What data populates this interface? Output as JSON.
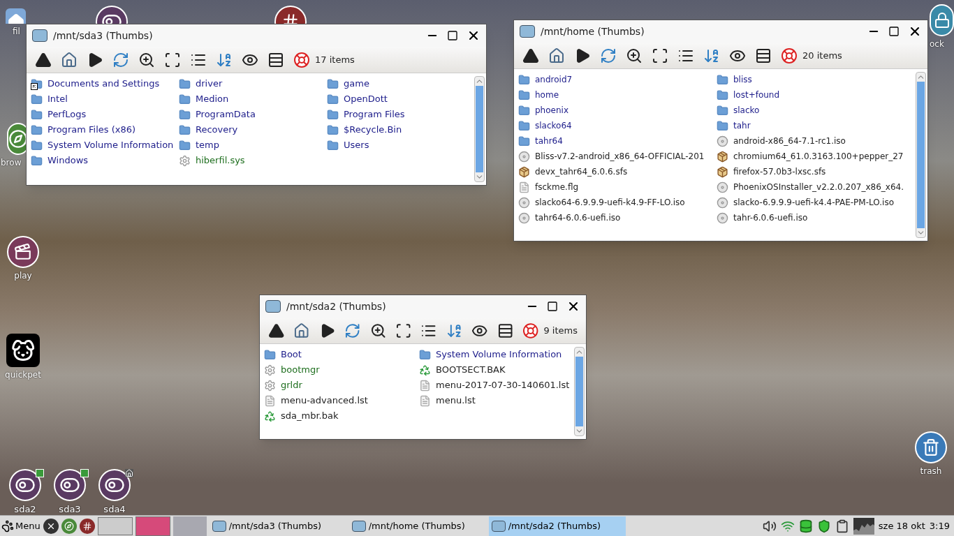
{
  "desktop_icons": [
    {
      "kind": "folder-home",
      "label": "fil"
    },
    {
      "kind": "toggle"
    },
    {
      "kind": "hash"
    },
    {
      "kind": "compass",
      "label": "brow"
    },
    {
      "kind": "clapper",
      "label": "play"
    },
    {
      "kind": "pet",
      "label": "quickpet"
    },
    {
      "kind": "lock",
      "label": "ock"
    },
    {
      "kind": "trash",
      "label": "trash"
    }
  ],
  "drives": [
    {
      "label": "sda2",
      "kind": "eject"
    },
    {
      "label": "sda3",
      "kind": "eject"
    },
    {
      "label": "sda4",
      "kind": "home"
    }
  ],
  "windows": [
    {
      "title": "/mnt/sda3 (Thumbs)",
      "item_count": "17 items",
      "columns": [
        [
          {
            "name": "Documents and Settings",
            "kind": "link-folder"
          },
          {
            "name": "Intel",
            "kind": "folder"
          },
          {
            "name": "PerfLogs",
            "kind": "folder"
          },
          {
            "name": "Program Files (x86)",
            "kind": "folder"
          },
          {
            "name": "System Volume Information",
            "kind": "folder"
          },
          {
            "name": "Windows",
            "kind": "folder"
          }
        ],
        [
          {
            "name": "driver",
            "kind": "folder"
          },
          {
            "name": "Medion",
            "kind": "folder"
          },
          {
            "name": "ProgramData",
            "kind": "folder"
          },
          {
            "name": "Recovery",
            "kind": "folder"
          },
          {
            "name": "temp",
            "kind": "folder"
          },
          {
            "name": "hiberfil.sys",
            "kind": "gear"
          }
        ],
        [
          {
            "name": "game",
            "kind": "folder"
          },
          {
            "name": "OpenDott",
            "kind": "folder"
          },
          {
            "name": "Program Files",
            "kind": "folder"
          },
          {
            "name": "$Recycle.Bin",
            "kind": "folder"
          },
          {
            "name": "Users",
            "kind": "folder"
          }
        ]
      ]
    },
    {
      "title": "/mnt/home (Thumbs)",
      "item_count": "20 items",
      "columns": [
        [
          {
            "name": "android7",
            "kind": "folder"
          },
          {
            "name": "home",
            "kind": "folder"
          },
          {
            "name": "phoenix",
            "kind": "folder"
          },
          {
            "name": "slacko64",
            "kind": "folder"
          },
          {
            "name": "tahr64",
            "kind": "folder"
          },
          {
            "name": "Bliss-v7.2-android_x86_64-OFFICIAL-201",
            "kind": "disc"
          },
          {
            "name": "devx_tahr64_6.0.6.sfs",
            "kind": "package"
          },
          {
            "name": "fsckme.flg",
            "kind": "text"
          },
          {
            "name": "slacko64-6.9.9.9-uefi-k4.9-FF-LO.iso",
            "kind": "disc"
          },
          {
            "name": "tahr64-6.0.6-uefi.iso",
            "kind": "disc"
          }
        ],
        [
          {
            "name": "bliss",
            "kind": "folder"
          },
          {
            "name": "lost+found",
            "kind": "folder"
          },
          {
            "name": "slacko",
            "kind": "folder"
          },
          {
            "name": "tahr",
            "kind": "folder"
          },
          {
            "name": "android-x86_64-7.1-rc1.iso",
            "kind": "disc"
          },
          {
            "name": "chromium64_61.0.3163.100+pepper_27",
            "kind": "package"
          },
          {
            "name": "firefox-57.0b3-lxsc.sfs",
            "kind": "package"
          },
          {
            "name": "PhoenixOSInstaller_v2.2.0.207_x86_x64.",
            "kind": "disc"
          },
          {
            "name": "slacko-6.9.9.9-uefi-k4.4-PAE-PM-LO.iso",
            "kind": "disc"
          },
          {
            "name": "tahr-6.0.6-uefi.iso",
            "kind": "disc"
          }
        ]
      ]
    },
    {
      "title": "/mnt/sda2 (Thumbs)",
      "item_count": "9 items",
      "columns": [
        [
          {
            "name": "Boot",
            "kind": "folder"
          },
          {
            "name": "bootmgr",
            "kind": "gear"
          },
          {
            "name": "grldr",
            "kind": "gear"
          },
          {
            "name": "menu-advanced.lst",
            "kind": "text"
          },
          {
            "name": "sda_mbr.bak",
            "kind": "recycle"
          }
        ],
        [
          {
            "name": "System Volume Information",
            "kind": "folder"
          },
          {
            "name": "BOOTSECT.BAK",
            "kind": "recycle"
          },
          {
            "name": "menu-2017-07-30-140601.lst",
            "kind": "text"
          },
          {
            "name": "menu.lst",
            "kind": "text"
          }
        ]
      ]
    }
  ],
  "taskbar": {
    "menu": "Menu",
    "tasks": [
      {
        "label": "/mnt/sda3 (Thumbs)",
        "selected": false
      },
      {
        "label": "/mnt/home (Thumbs)",
        "selected": false
      },
      {
        "label": "/mnt/sda2 (Thumbs)",
        "selected": true
      }
    ],
    "date": "sze 18 okt",
    "time": "3:19"
  }
}
